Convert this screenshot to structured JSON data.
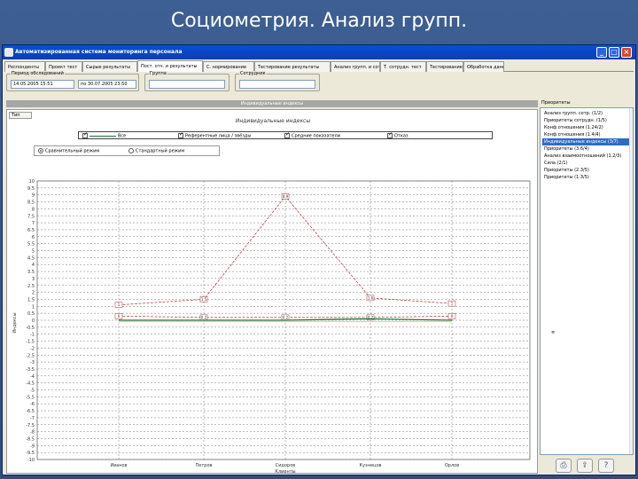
{
  "slide": {
    "title": "Социометрия. Анализ групп."
  },
  "window": {
    "title": "Автоматизированная система мониторинга персонала",
    "controls": {
      "minimize": "_",
      "maximize": "□",
      "close": "×"
    }
  },
  "tabs": [
    "Респонденты",
    "Проект тест",
    "Сырые результаты",
    "Пост. отч. и результаты",
    "С. нормирование",
    "Тестирование результаты",
    "Анализ групп. и сотрудн.",
    "Т. сотрудн. тест",
    "Тестирование п.",
    "Обработка данных"
  ],
  "filters": {
    "period": {
      "label": "Период обследований",
      "from": "14.05.2005 15:51",
      "to": "по 30.07.2005 23:50"
    },
    "group1": {
      "label": "Группа",
      "value": ""
    },
    "group2": {
      "label": "Сотрудник",
      "value": ""
    }
  },
  "chart_header": "Индивидуальные индексы",
  "view_tab": "Тип",
  "chart_data": {
    "type": "line",
    "title": "Индивидуальные индексы",
    "legend": [
      {
        "label": "Все",
        "checked": true
      },
      {
        "label": "Референтные лица / звёзды",
        "checked": true
      },
      {
        "label": "Средние показатели",
        "checked": true
      },
      {
        "label": "Отказ",
        "checked": true
      }
    ],
    "modes": [
      {
        "label": "Сравнительный режим",
        "selected": true
      },
      {
        "label": "Стандартный режим",
        "selected": false
      }
    ],
    "ylabel": "Индексы",
    "xlabel": "Клиенты",
    "ylim": [
      -10,
      10
    ],
    "yticks": [
      10,
      9.5,
      9,
      8.5,
      8,
      7.5,
      7,
      6.5,
      6,
      5.5,
      5,
      4.5,
      4,
      3.5,
      3,
      2.5,
      2,
      1.5,
      1,
      0.5,
      0,
      -0.5,
      -1,
      -1.5,
      -2,
      -2.5,
      -3,
      -3.5,
      -4,
      -4.5,
      -5,
      -5.5,
      -6,
      -6.5,
      -7,
      -7.5,
      -8,
      -8.5,
      -9,
      -9.5,
      -10
    ],
    "categories": [
      "Иванов",
      "Петров",
      "Сидоров",
      "Кузнецов",
      "Орлов"
    ],
    "series": [
      {
        "values": [
          1.1,
          1.5,
          8.9,
          1.6,
          1.2
        ],
        "color": "#b03030",
        "point_labels": [
          "1",
          "1.5",
          "8.9",
          "1.6",
          "1"
        ]
      },
      {
        "values": [
          0.3,
          0.2,
          0.2,
          0.2,
          0.3
        ],
        "color": "#b03030",
        "point_labels": [
          "0",
          "0.2",
          "0.2",
          "0.2",
          "0"
        ]
      },
      {
        "values": [
          0.0,
          0.0,
          0.0,
          0.1,
          0.0
        ],
        "color": "#1f6f2f"
      },
      {
        "values": [
          -0.1,
          -0.1,
          -0.1,
          -0.1,
          -0.1
        ],
        "color": "#e9d86b"
      }
    ]
  },
  "right_panel": {
    "label": "Приоритеты",
    "items": [
      "Анализ групп. сотр. (1/2)",
      "Приоритеты сотрудн. (1/5)",
      "Конф.отношения (1.24/2)",
      "Конф.отношения (1.4/4)",
      "Индивидуальные индексы (3/7)",
      "Приоритеты (3.6/4)",
      "Анализ взаимоотношений (1.2/3)",
      "Сила (2/1)",
      "Приоритеты (2.3/5)",
      "Приоритеты (1.3/5)"
    ],
    "selected_index": 4,
    "scroll_glyph": "≡"
  },
  "bottom_icons": [
    "printer-icon",
    "export-icon",
    "help-icon"
  ]
}
